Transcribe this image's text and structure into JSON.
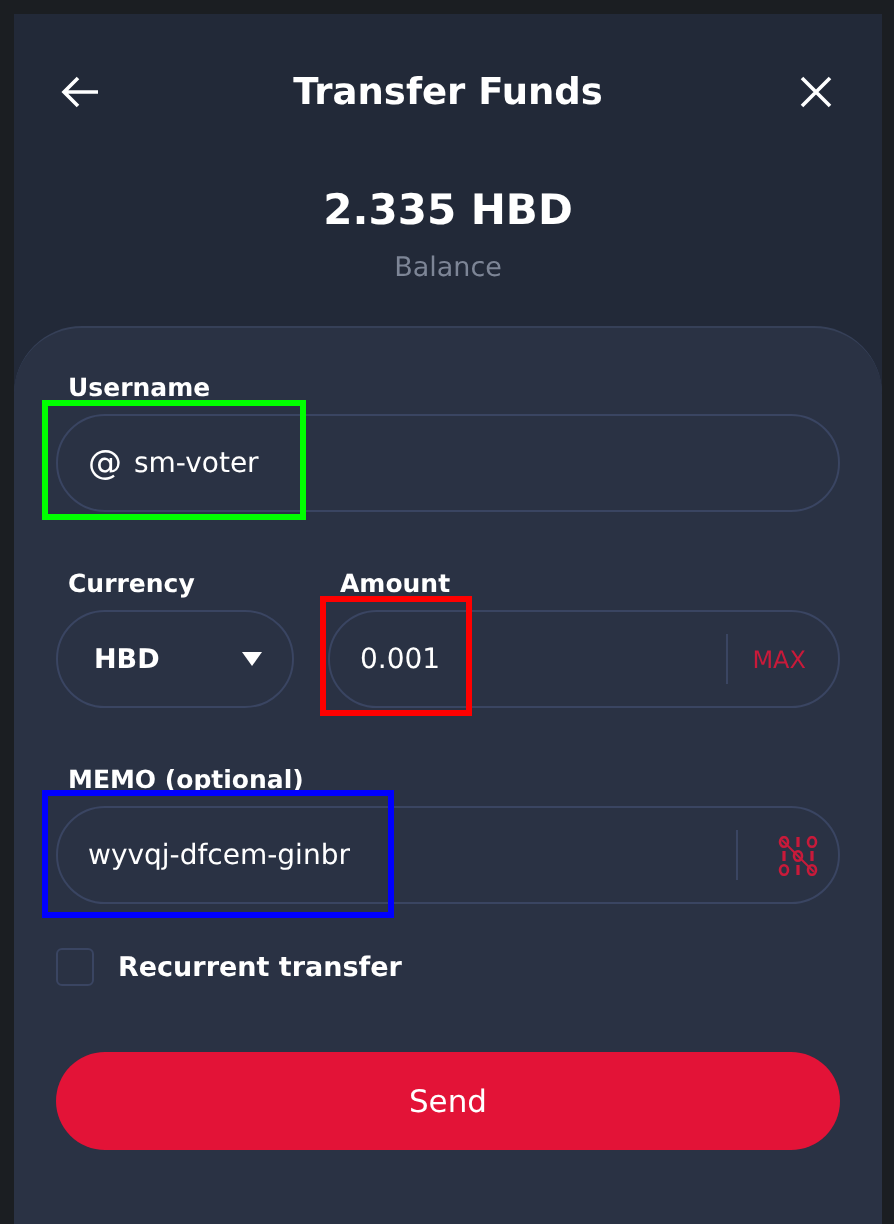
{
  "dialog": {
    "title": "Transfer Funds",
    "balance": {
      "amount": "2.335 HBD",
      "label": "Balance"
    }
  },
  "fields": [
    {
      "kind": "text",
      "label": "Username",
      "prefix": "@",
      "value": "sm-voter",
      "color": "#00ff00"
    },
    {
      "kind": "select",
      "label": "Currency",
      "value": "HBD"
    },
    {
      "kind": "amount",
      "label": "Amount",
      "value": "0.001",
      "action": "MAX",
      "color": "#ff0000"
    },
    {
      "kind": "memo",
      "label": "MEMO (optional)",
      "value": "wyvqj-dfcem-ginbr",
      "color": "#0000ff"
    }
  ],
  "recurrent": {
    "label": "Recurrent transfer",
    "checked": false
  },
  "send_button": "Send"
}
